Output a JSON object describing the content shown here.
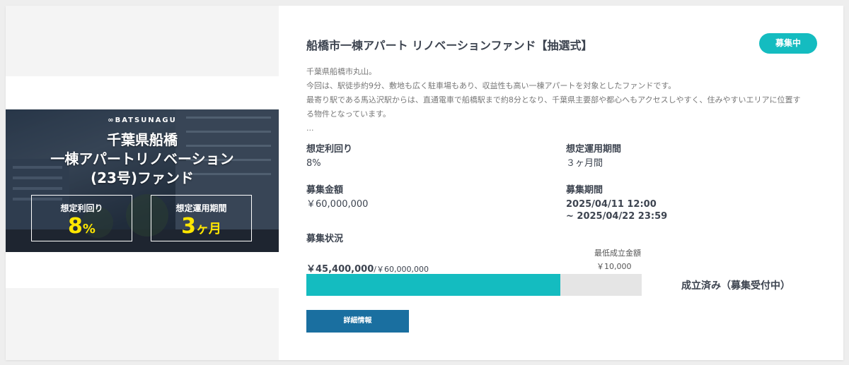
{
  "fund": {
    "title": "船橋市一棟アパート リノベーションファンド【抽選式】",
    "status": "募集中",
    "description": [
      "千葉県船橋市丸山。",
      "今回は、駅徒歩約9分、敷地も広く駐車場もあり、収益性も高い一棟アパートを対象としたファンドです。",
      "最寄り駅である馬込沢駅からは、直通電車で船橋駅まで約8分となり、千葉県主要部や都心へもアクセスしやすく、住みやすいエリアに位置す",
      "る物件となっています。",
      "..."
    ]
  },
  "hero": {
    "brand": "∞BATSUNAGU",
    "title_lines": [
      "千葉県船橋",
      "一棟アパートリノベーション",
      "(23号)ファンド"
    ],
    "yield_label": "想定利回り",
    "yield_value": "8",
    "yield_unit": "%",
    "period_label": "想定運用期間",
    "period_value": "3",
    "period_unit": "ヶ月"
  },
  "details": {
    "yield_label": "想定利回り",
    "yield_value": "8%",
    "period_label": "想定運用期間",
    "period_value": "３ヶ月間",
    "amount_label": "募集金額",
    "amount_value": "￥60,000,000",
    "recruit_period_label": "募集期間",
    "recruit_period_start": "2025/04/11 12:00",
    "recruit_period_end": "~ 2025/04/22 23:59",
    "recruit_status_label": "募集状況"
  },
  "progress": {
    "raised": "￥45,400,000",
    "target": "/￥60,000,000",
    "min_label": "最低成立金額",
    "min_value": "￥10,000",
    "fraction": 0.7567,
    "result": "成立済み（募集受付中）"
  },
  "detail_button_label": "詳細情報",
  "colors": {
    "accent": "#14bcc0",
    "button": "#1a6fa0",
    "hero_highlight": "#ffe600"
  }
}
